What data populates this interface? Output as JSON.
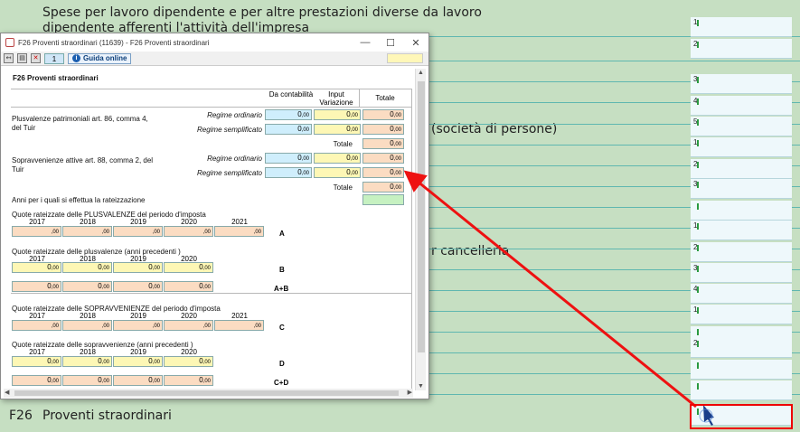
{
  "background": {
    "heading_line1": "Spese per lavoro dipendente e per altre prestazioni diverse da lavoro",
    "heading_line2": "dipendente afferenti l'attività dell'impresa",
    "text_societa": "(società di persone)",
    "text_cancelleria": "r cancelleria",
    "footer_code": "F26",
    "footer_label": "Proventi straordinari",
    "field_numbers": [
      "1",
      "2",
      "3",
      "4",
      "5",
      "1",
      "2",
      "3",
      "",
      "1",
      "2",
      "3",
      "4",
      "1",
      "",
      "2",
      "",
      ""
    ],
    "value_1": "92",
    "value_2": "92"
  },
  "dialog": {
    "title": "F26 Proventi straordinari (11639) - F26 Proventi straordinari",
    "minimize": "—",
    "maximize": "☐",
    "close": "✕",
    "toolbar_number": "1",
    "help_label": "Guida online",
    "section_title": "F26 Proventi straordinari",
    "col_contabilita": "Da contabilità",
    "col_input": "Input Variazione",
    "col_totale": "Totale",
    "plus_label": "Plusvalenze patrimoniali art. 86, comma 4, del Tuir",
    "sopr_label": "Sopravvenienze attive art. 88, comma 2, del Tuir",
    "regime_ordinario": "Regime ordinario",
    "regime_semplificato": "Regime semplificato",
    "totale_label": "Totale",
    "zero": "0",
    "dec": ",00",
    "anni_label": "Anni per i quali si effettua la rateizzazione",
    "q_plus_periodo": "Quote rateizzate delle PLUSVALENZE del periodo d'imposta",
    "q_plus_prec": "Quote rateizzate delle plusvalenze (anni precedenti )",
    "q_sopr_periodo": "Quote rateizzate delle SOPRAVVENIENZE del periodo d'imposta",
    "q_sopr_prec": "Quote rateizzate delle sopravvenienze (anni precedenti )",
    "years5": [
      "2017",
      "2018",
      "2019",
      "2020",
      "2021"
    ],
    "years4": [
      "2017",
      "2018",
      "2019",
      "2020"
    ],
    "letter_a": "A",
    "letter_b": "B",
    "letter_ab": "A+B",
    "letter_c": "C",
    "letter_d": "D",
    "letter_cd": "C+D"
  }
}
